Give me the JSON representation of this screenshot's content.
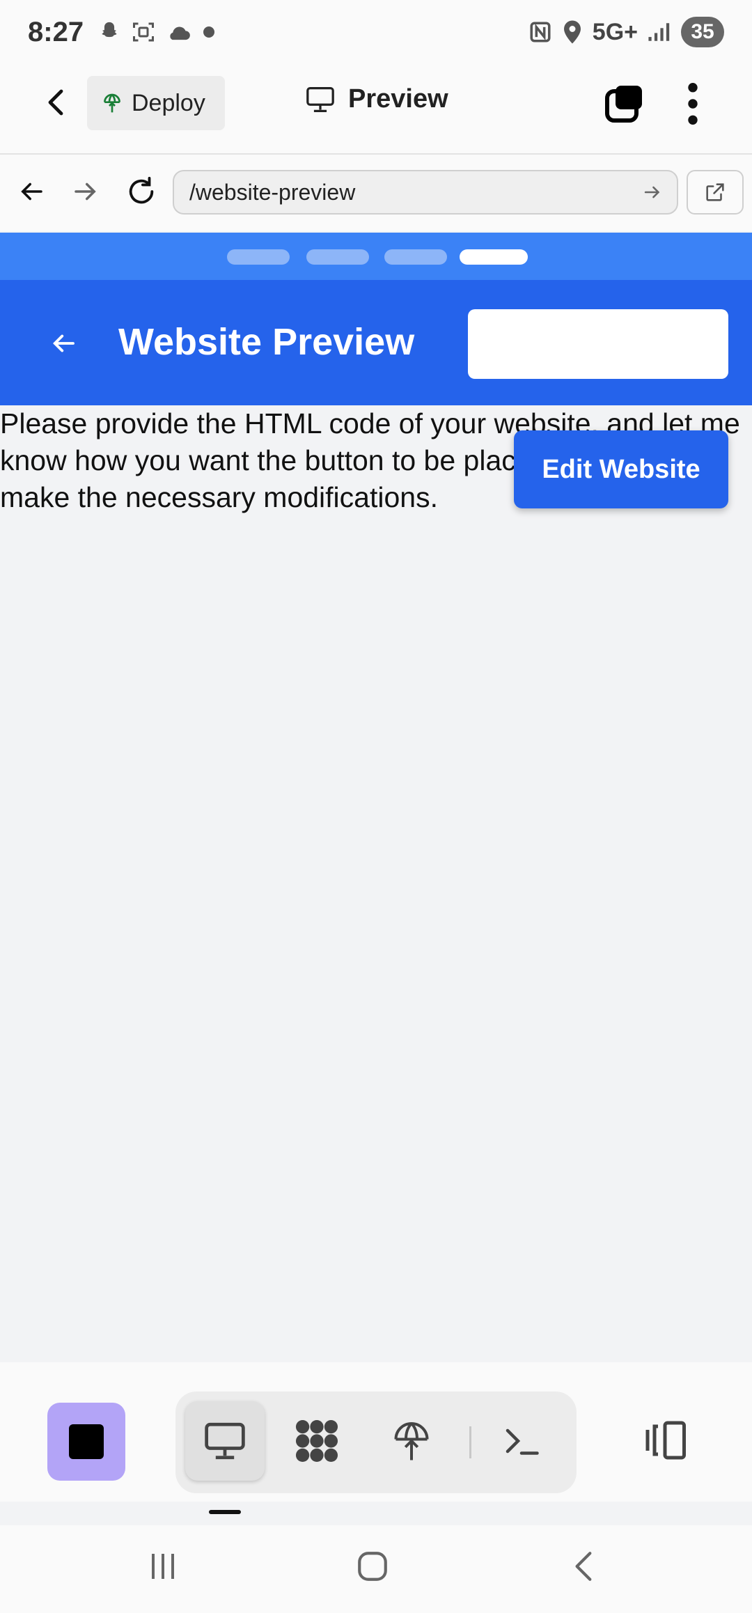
{
  "status_bar": {
    "time": "8:27",
    "network": "5G+",
    "battery": "35",
    "left_icons": [
      "snapchat-icon",
      "screenshot-icon",
      "cloud-icon",
      "dot-icon"
    ],
    "right_icons": [
      "nfc-icon",
      "location-icon",
      "signal-icon"
    ]
  },
  "app_bar": {
    "deploy_label": "Deploy",
    "title": "Preview"
  },
  "browser": {
    "url": "/website-preview"
  },
  "page_progress": {
    "total_steps": 4,
    "current_step": 4
  },
  "website": {
    "header_title": "Website Preview",
    "body_text": "Please provide the HTML code of your website, and let me know how you want the button to be placed, so that I can make the necessary modifications.",
    "edit_button_label": "Edit Website"
  },
  "bottom_toolbar": {
    "tools": [
      "monitor-icon",
      "apps-icon",
      "deploy-icon",
      "terminal-icon"
    ],
    "active_tool": "monitor-icon"
  },
  "colors": {
    "primary_blue": "#2563eb",
    "strip_blue": "#3b82f6",
    "stop_purple": "#b3a4f7"
  }
}
